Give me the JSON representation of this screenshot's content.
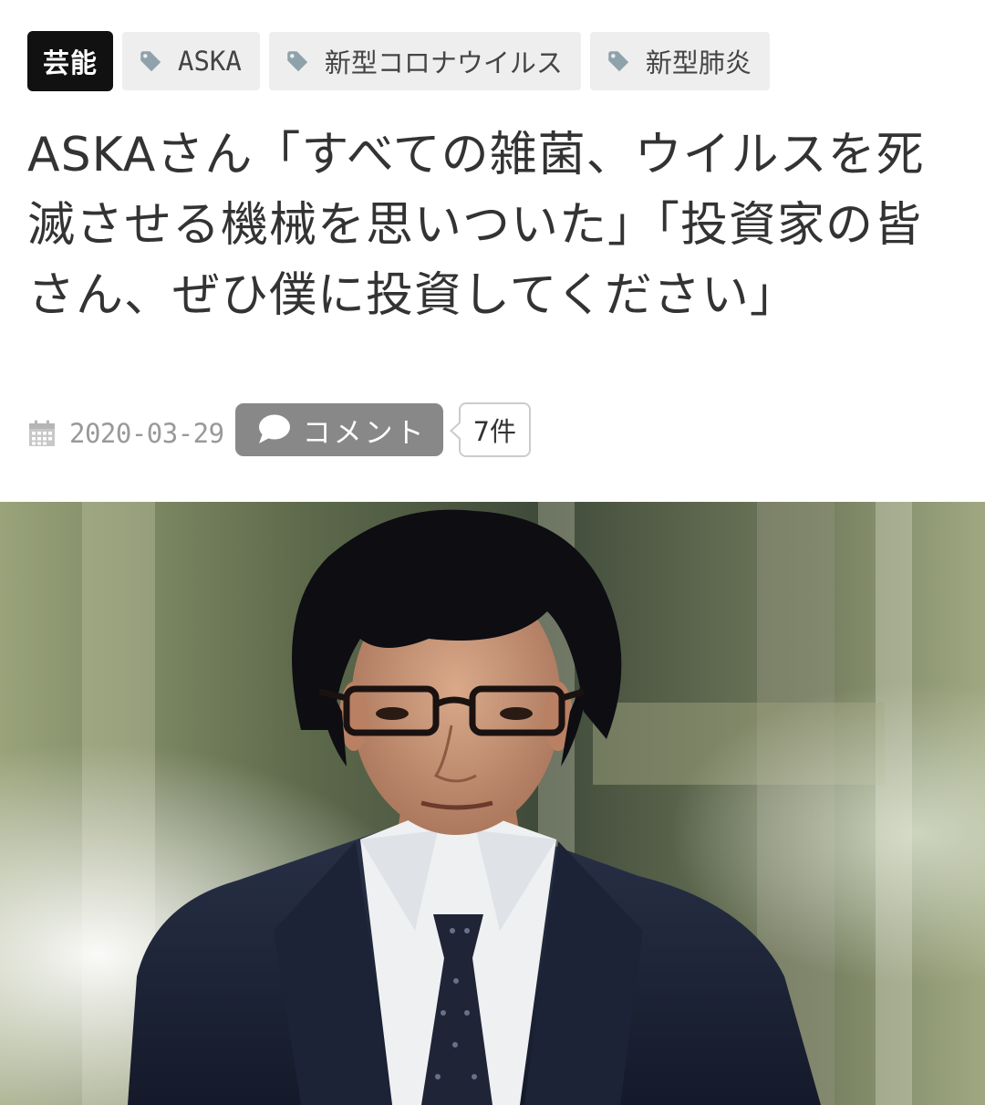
{
  "header": {
    "category": "芸能",
    "tags": [
      {
        "label": "ASKA",
        "icon": "tag-icon"
      },
      {
        "label": "新型コロナウイルス",
        "icon": "tag-icon"
      },
      {
        "label": "新型肺炎",
        "icon": "tag-icon"
      }
    ]
  },
  "article": {
    "title": "ASKAさん「すべての雑菌、ウイルスを死滅させる機械を思いついた」「投資家の皆さん、ぜひ僕に投資してください」",
    "date": "2020-03-29",
    "comment_button_label": "コメント",
    "comment_count": "7件"
  },
  "photo": {
    "alt": "ASKA"
  },
  "colors": {
    "category_bg": "#111111",
    "tag_bg": "#eeeeee",
    "comment_button_bg": "#888888",
    "title_text": "#333333",
    "meta_text": "#999999"
  }
}
